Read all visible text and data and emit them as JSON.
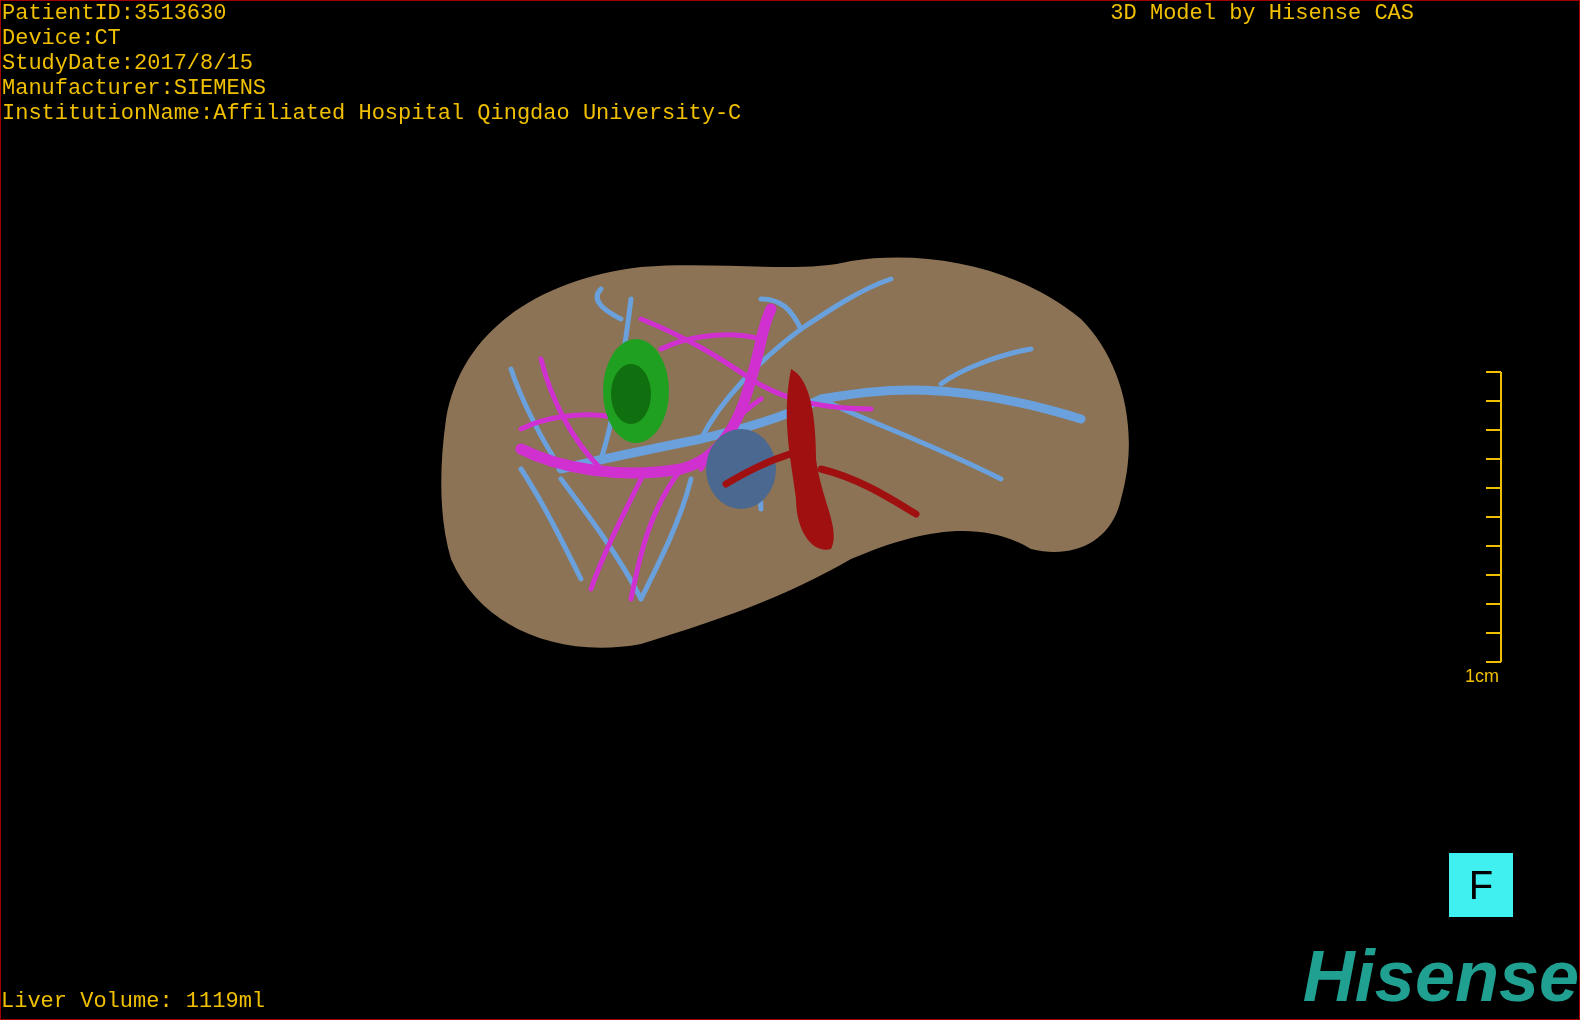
{
  "info_lines": [
    "PatientID:3513630",
    "Device:CT",
    "StudyDate:2017/8/15",
    "Manufacturer:SIEMENS",
    "InstitutionName:Affiliated Hospital Qingdao University-C"
  ],
  "title": "3D Model by Hisense CAS",
  "scale": {
    "label": "1cm"
  },
  "orientation": "F",
  "liver_volume": "Liver Volume: 1119ml",
  "logo": "Hisense"
}
